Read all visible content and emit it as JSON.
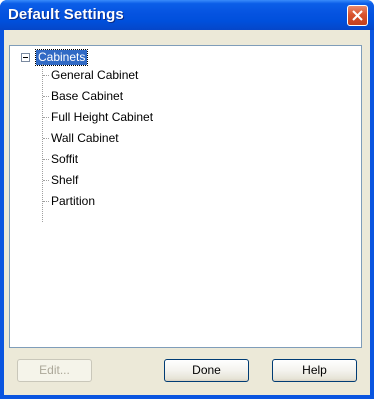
{
  "window": {
    "title": "Default Settings"
  },
  "tree": {
    "root": {
      "label": "Cabinets",
      "expanded": true,
      "selected": true
    },
    "children": [
      {
        "label": "General Cabinet"
      },
      {
        "label": "Base Cabinet"
      },
      {
        "label": "Full Height Cabinet"
      },
      {
        "label": "Wall Cabinet"
      },
      {
        "label": "Soffit"
      },
      {
        "label": "Shelf"
      },
      {
        "label": "Partition"
      }
    ]
  },
  "buttons": {
    "edit": {
      "label": "Edit...",
      "enabled": false
    },
    "done": {
      "label": "Done",
      "enabled": true
    },
    "help": {
      "label": "Help",
      "enabled": true
    }
  },
  "icons": {
    "close": "close-icon",
    "expander": "minus-box-icon"
  },
  "colors": {
    "title_bar": "#0553e0",
    "close_button": "#d9532e",
    "dialog_face": "#ece9d8",
    "selection": "#316ac5",
    "tree_border": "#7f9db9",
    "disabled_text": "#aca899"
  }
}
